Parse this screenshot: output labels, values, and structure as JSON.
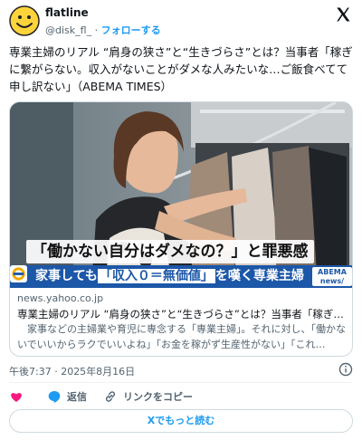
{
  "header": {
    "display_name": "flatline",
    "handle": "@disk_fl_",
    "separator": "·",
    "follow_label": "フォローする"
  },
  "tweet": {
    "text": "専業主婦のリアル “肩身の狭さ”と“生きづらさ”とは？当事者「稼ぎに繋がらない。収入がないことがダメな人みたいな…ご飯食べてて申し訳ない」（ABEMA TIMES）"
  },
  "card": {
    "image_caption_top": "「働かない自分はダメなの？」と罪悪感",
    "image_caption_bottom_pre": "家事しても",
    "image_caption_bottom_highlight": "「収入０＝無価値」",
    "image_caption_bottom_post": "を嘆く専業主婦",
    "image_badge_line1": "ABEMA",
    "image_badge_line2": "news/",
    "domain": "news.yahoo.co.jp",
    "title": "専業主婦のリアル “肩身の狭さ”と“生きづらさ”とは？当事者「稼ぎに繋…",
    "description": "　家事などの主婦業や育児に専念する「専業主婦」。それに対し、「働かないでいいからラクでいいよね」「お金を稼がず生産性がない」「これ…"
  },
  "meta": {
    "timestamp": "午後7:37 · 2025年8月16日"
  },
  "actions": {
    "reply_label": "返信",
    "copy_link_label": "リンクをコピー"
  },
  "footer": {
    "read_more_label": "Xでもっと読む"
  },
  "colors": {
    "accent": "#1d9bf0",
    "like": "#f91880",
    "caption_band": "#1c57a8",
    "avatar_yellow": "#ffd43b"
  }
}
